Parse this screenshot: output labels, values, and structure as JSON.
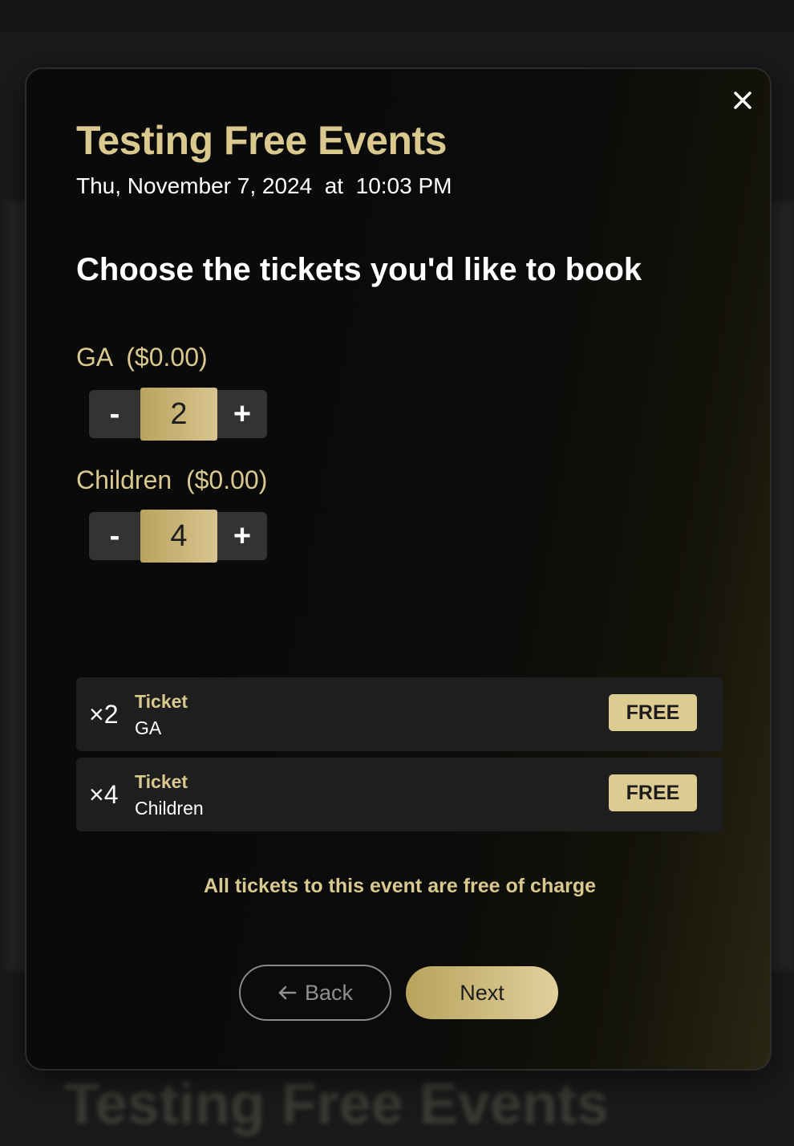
{
  "modal": {
    "event_title": "Testing Free Events",
    "event_date": "Thu, November 7, 2024  at  10:03 PM",
    "heading": "Choose the tickets you'd like to book",
    "ticket_types": [
      {
        "label": "GA  ($0.00)",
        "quantity": "2",
        "minus": "-",
        "plus": "+"
      },
      {
        "label": "Children  ($0.00)",
        "quantity": "4",
        "minus": "-",
        "plus": "+"
      }
    ],
    "summary": [
      {
        "qty": "×2",
        "kind": "Ticket",
        "name": "GA",
        "price": "FREE"
      },
      {
        "qty": "×4",
        "kind": "Ticket",
        "name": "Children",
        "price": "FREE"
      }
    ],
    "free_note": "All tickets to this event are free of charge",
    "back_label": "Back",
    "next_label": "Next"
  },
  "background": {
    "title": "Testing Free Events"
  },
  "icons": {
    "close": "close-icon",
    "back_arrow": "arrow-left-icon"
  },
  "colors": {
    "gold": "#d9c98f",
    "gold_button": "#ddcc91",
    "modal_bg": "#0a0a0a",
    "row_bg": "#1e1e1e"
  }
}
